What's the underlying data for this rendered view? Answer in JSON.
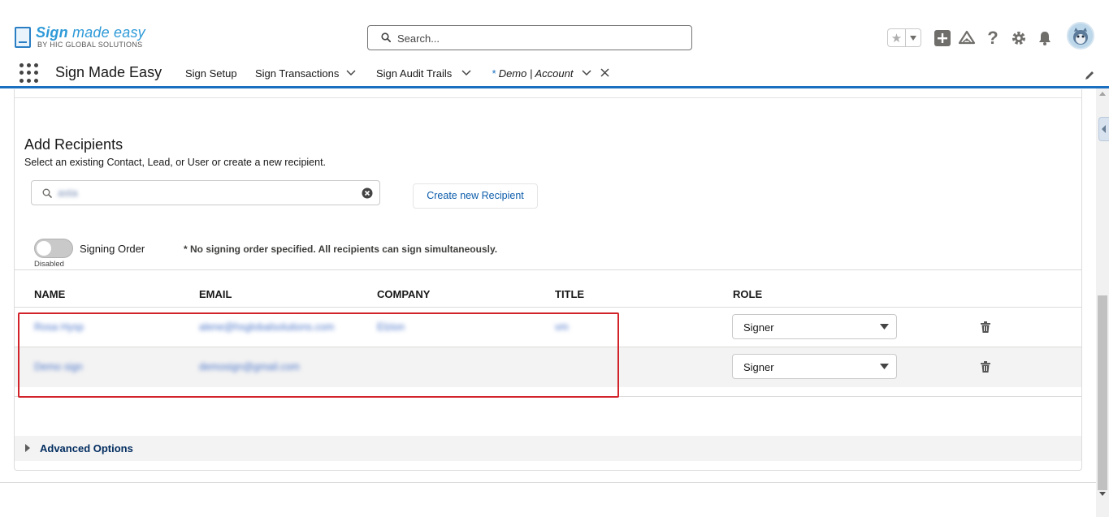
{
  "logo": {
    "title_bold": "Sign",
    "title_rest": " made easy",
    "subtitle": "BY HIC GLOBAL SOLUTIONS"
  },
  "search": {
    "placeholder": "Search..."
  },
  "nav": {
    "app_name": "Sign Made Easy",
    "items": [
      {
        "label": "Sign Setup"
      },
      {
        "label": "Sign Transactions"
      },
      {
        "label": "Sign Audit Trails"
      }
    ],
    "active_tab": {
      "marker": "*",
      "label": "Demo | Account"
    }
  },
  "recipients": {
    "title": "Add Recipients",
    "subtitle": "Select an existing Contact, Lead, or User or create a new recipient.",
    "lookup_value": "asta",
    "create_button": "Create new Recipient",
    "signing_order_label": "Signing Order",
    "signing_order_state": "Disabled",
    "signing_order_note": "* No signing order specified. All recipients can sign simultaneously.",
    "columns": [
      "NAME",
      "EMAIL",
      "COMPANY",
      "TITLE",
      "ROLE"
    ],
    "rows": [
      {
        "name": "Rosa Hysp",
        "email": "alene@hsglobalsolutions.com",
        "company": "Elzion",
        "title": "vm",
        "role": "Signer"
      },
      {
        "name": "Demo sign",
        "email": "demosign@gmail.com",
        "company": "",
        "title": "",
        "role": "Signer"
      }
    ]
  },
  "advanced": {
    "label": "Advanced Options"
  },
  "colors": {
    "brand_blue": "#1b6fc0",
    "link_blue": "#0b5cab",
    "highlight_red": "#d2232a",
    "logo_blue": "#2e9ad8"
  },
  "icons": [
    "star-icon",
    "add-icon",
    "trailhead-icon",
    "help-icon",
    "gear-icon",
    "bell-icon",
    "app-launcher-icon",
    "search-icon",
    "clear-icon",
    "trash-icon",
    "edit-icon",
    "close-icon",
    "chevron-down-icon"
  ]
}
